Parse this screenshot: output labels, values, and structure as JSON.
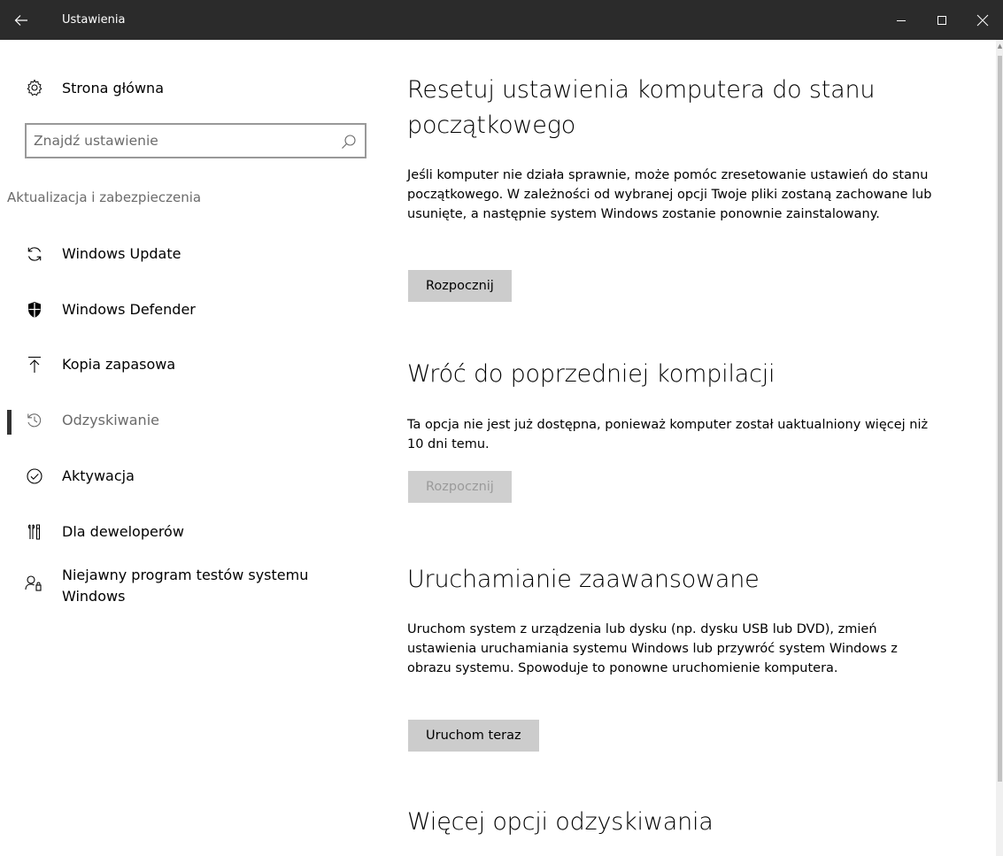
{
  "window": {
    "title": "Ustawienia",
    "back_icon": "arrow-left-icon",
    "minimize_icon": "minimize-icon",
    "maximize_icon": "maximize-icon",
    "close_icon": "close-icon"
  },
  "sidebar": {
    "home_label": "Strona główna",
    "search_placeholder": "Znajdź ustawienie",
    "section_label": "Aktualizacja i zabezpieczenia",
    "items": [
      {
        "label": "Windows Update",
        "icon": "sync-icon",
        "active": false
      },
      {
        "label": "Windows Defender",
        "icon": "shield-icon",
        "active": false
      },
      {
        "label": "Kopia zapasowa",
        "icon": "upload-icon",
        "active": false
      },
      {
        "label": "Odzyskiwanie",
        "icon": "history-icon",
        "active": true
      },
      {
        "label": "Aktywacja",
        "icon": "check-circle-icon",
        "active": false
      },
      {
        "label": "Dla deweloperów",
        "icon": "developer-tools-icon",
        "active": false
      },
      {
        "label": "Niejawny program testów systemu Windows",
        "icon": "insider-icon",
        "active": false
      }
    ]
  },
  "main": {
    "reset": {
      "heading": "Resetuj ustawienia komputera do stanu początkowego",
      "body": "Jeśli komputer nie działa sprawnie, może pomóc zresetowanie ustawień do stanu początkowego. W zależności od wybranej opcji Twoje pliki zostaną zachowane lub usunięte, a następnie system Windows zostanie ponownie zainstalowany.",
      "button": "Rozpocznij"
    },
    "rollback": {
      "heading": "Wróć do poprzedniej kompilacji",
      "body": "Ta opcja nie jest już dostępna, ponieważ komputer został uaktualniony więcej niż 10 dni temu.",
      "button": "Rozpocznij"
    },
    "advanced": {
      "heading": "Uruchamianie zaawansowane",
      "body": "Uruchom system z urządzenia lub dysku (np. dysku USB lub DVD), zmień ustawienia uruchamiania systemu Windows lub przywróć system Windows z obrazu systemu. Spowoduje to ponowne uruchomienie komputera.",
      "button": "Uruchom teraz"
    },
    "more": {
      "heading": "Więcej opcji odzyskiwania"
    }
  },
  "colors": {
    "titlebar": "#2b2b2b",
    "button": "#cccccc",
    "muted_text": "#6b6b6b"
  }
}
